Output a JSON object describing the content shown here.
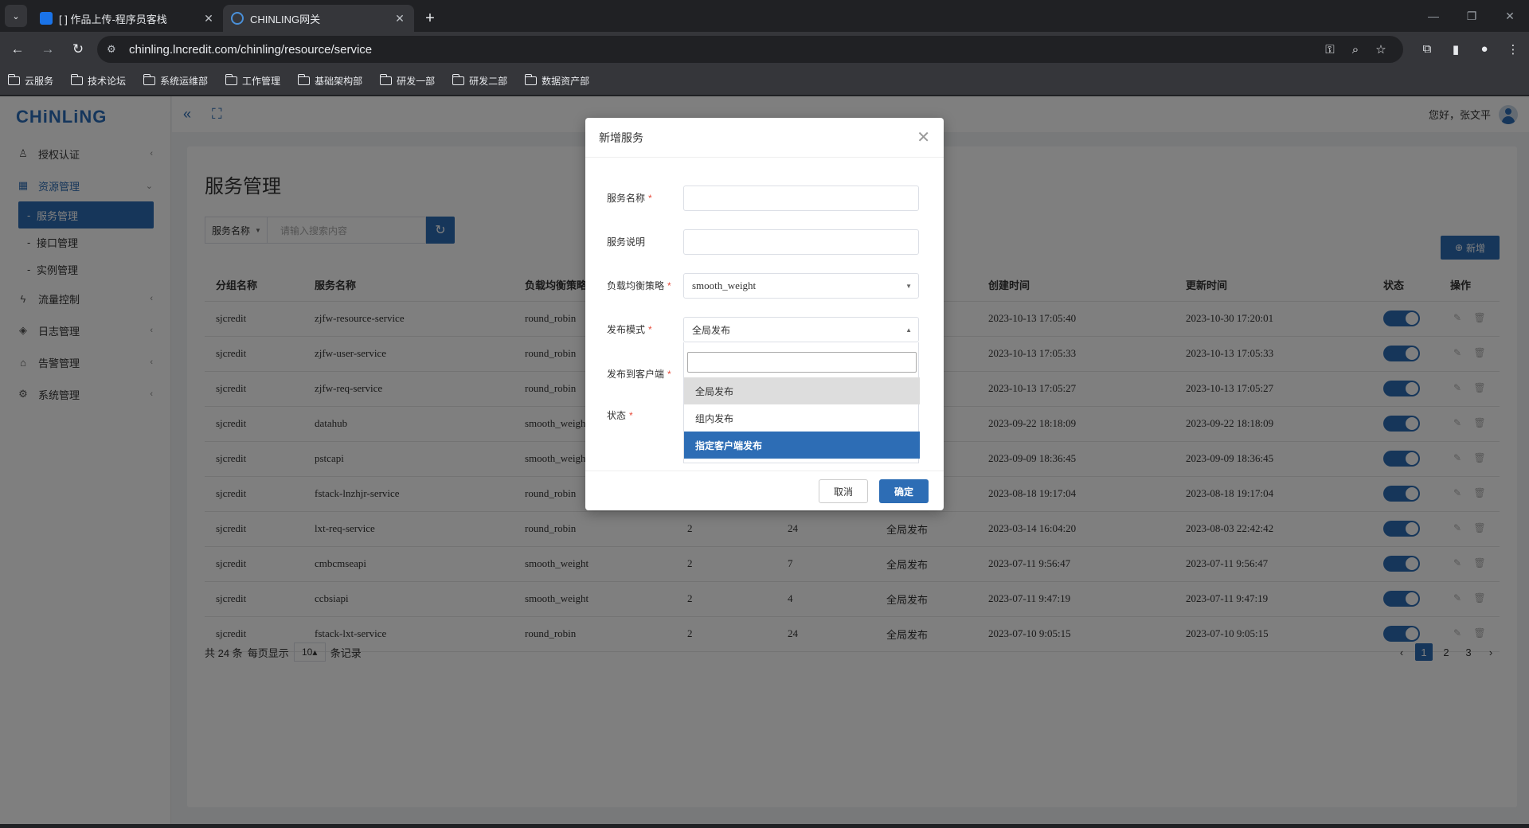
{
  "browser": {
    "tabs": [
      {
        "title": "[        ] 作品上传-程序员客栈"
      },
      {
        "title": "CHINLING网关"
      }
    ],
    "url": "chinling.lncredit.com/chinling/resource/service",
    "bookmarks": [
      "云服务",
      "技术论坛",
      "系统运维部",
      "工作管理",
      "基础架构部",
      "研发一部",
      "研发二部",
      "数据资产部"
    ]
  },
  "app": {
    "logo": "CHiNLiNG",
    "greeting": "您好，张文平",
    "menu": [
      {
        "label": "授权认证",
        "icon": "user-icon"
      },
      {
        "label": "资源管理",
        "icon": "grid-icon",
        "expanded": true
      },
      {
        "label": "流量控制",
        "icon": "flow-icon"
      },
      {
        "label": "日志管理",
        "icon": "layers-icon"
      },
      {
        "label": "告警管理",
        "icon": "alarm-icon"
      },
      {
        "label": "系统管理",
        "icon": "gear-icon"
      }
    ],
    "submenu": [
      "服务管理",
      "接口管理",
      "实例管理"
    ]
  },
  "page": {
    "title": "服务管理",
    "search_field": "服务名称",
    "search_placeholder": "请输入搜索内容",
    "add_label": "新增",
    "columns": [
      "分组名称",
      "服务名称",
      "负载均衡策略",
      "",
      "",
      "",
      "创建时间",
      "更新时间",
      "状态",
      "操作"
    ],
    "rows": [
      {
        "group": "sjcredit",
        "name": "zjfw-resource-service",
        "lb": "round_robin",
        "c4": "",
        "c5": "",
        "mode": "",
        "created": "2023-10-13 17:05:40",
        "updated": "2023-10-30 17:20:01"
      },
      {
        "group": "sjcredit",
        "name": "zjfw-user-service",
        "lb": "round_robin",
        "c4": "",
        "c5": "",
        "mode": "",
        "created": "2023-10-13 17:05:33",
        "updated": "2023-10-13 17:05:33"
      },
      {
        "group": "sjcredit",
        "name": "zjfw-req-service",
        "lb": "round_robin",
        "c4": "",
        "c5": "",
        "mode": "",
        "created": "2023-10-13 17:05:27",
        "updated": "2023-10-13 17:05:27"
      },
      {
        "group": "sjcredit",
        "name": "datahub",
        "lb": "smooth_weight",
        "c4": "",
        "c5": "",
        "mode": "",
        "created": "2023-09-22 18:18:09",
        "updated": "2023-09-22 18:18:09"
      },
      {
        "group": "sjcredit",
        "name": "pstcapi",
        "lb": "smooth_weight",
        "c4": "",
        "c5": "",
        "mode": "",
        "created": "2023-09-09 18:36:45",
        "updated": "2023-09-09 18:36:45"
      },
      {
        "group": "sjcredit",
        "name": "fstack-lnzhjr-service",
        "lb": "round_robin",
        "c4": "",
        "c5": "",
        "mode": "",
        "created": "2023-08-18 19:17:04",
        "updated": "2023-08-18 19:17:04"
      },
      {
        "group": "sjcredit",
        "name": "lxt-req-service",
        "lb": "round_robin",
        "c4": "2",
        "c5": "24",
        "mode": "全局发布",
        "created": "2023-03-14 16:04:20",
        "updated": "2023-08-03 22:42:42"
      },
      {
        "group": "sjcredit",
        "name": "cmbcmseapi",
        "lb": "smooth_weight",
        "c4": "2",
        "c5": "7",
        "mode": "全局发布",
        "created": "2023-07-11 9:56:47",
        "updated": "2023-07-11 9:56:47"
      },
      {
        "group": "sjcredit",
        "name": "ccbsiapi",
        "lb": "smooth_weight",
        "c4": "2",
        "c5": "4",
        "mode": "全局发布",
        "created": "2023-07-11 9:47:19",
        "updated": "2023-07-11 9:47:19"
      },
      {
        "group": "sjcredit",
        "name": "fstack-lxt-service",
        "lb": "round_robin",
        "c4": "2",
        "c5": "24",
        "mode": "全局发布",
        "created": "2023-07-10 9:05:15",
        "updated": "2023-07-10 9:05:15"
      }
    ],
    "footer": {
      "total": "共 24 条",
      "per_page_label": "每页显示",
      "per_page": "10",
      "suffix": "条记录"
    },
    "pages": [
      "1",
      "2",
      "3"
    ]
  },
  "modal": {
    "title": "新增服务",
    "fields": {
      "name_label": "服务名称",
      "desc_label": "服务说明",
      "lb_label": "负载均衡策略",
      "lb_value": "smooth_weight",
      "mode_label": "发布模式",
      "mode_value": "全局发布",
      "client_label": "发布到客户端",
      "status_label": "状态"
    },
    "options": [
      "全局发布",
      "组内发布",
      "指定客户端发布"
    ],
    "cancel": "取消",
    "ok": "确定"
  },
  "colors": {
    "accent": "#2d6db5",
    "required": "#e74c3c"
  }
}
